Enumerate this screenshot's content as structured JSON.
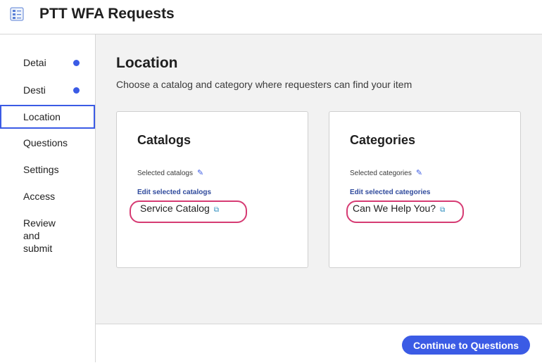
{
  "header": {
    "title": "PTT WFA Requests",
    "icon": "checklist-icon"
  },
  "sidebar": {
    "items": [
      {
        "label": "Detai",
        "has_dot": true
      },
      {
        "label": "Desti",
        "has_dot": true
      },
      {
        "label": "Location",
        "active": true
      },
      {
        "label": "Questions"
      },
      {
        "label": "Settings"
      },
      {
        "label": "Access"
      },
      {
        "label": "Review and submit"
      }
    ],
    "dot_color": "#3b5be5"
  },
  "main": {
    "title": "Location",
    "subtitle": "Choose a catalog and category where requesters can find your item",
    "catalogs": {
      "title": "Catalogs",
      "selected_label": "Selected catalogs",
      "edit_label": "Edit selected catalogs",
      "item": "Service Catalog"
    },
    "categories": {
      "title": "Categories",
      "selected_label": "Selected categories",
      "edit_label": "Edit selected categories",
      "item": "Can We Help You?"
    }
  },
  "footer": {
    "continue_label": "Continue to Questions"
  },
  "colors": {
    "accent": "#3b5be5",
    "highlight": "#d63b73"
  }
}
